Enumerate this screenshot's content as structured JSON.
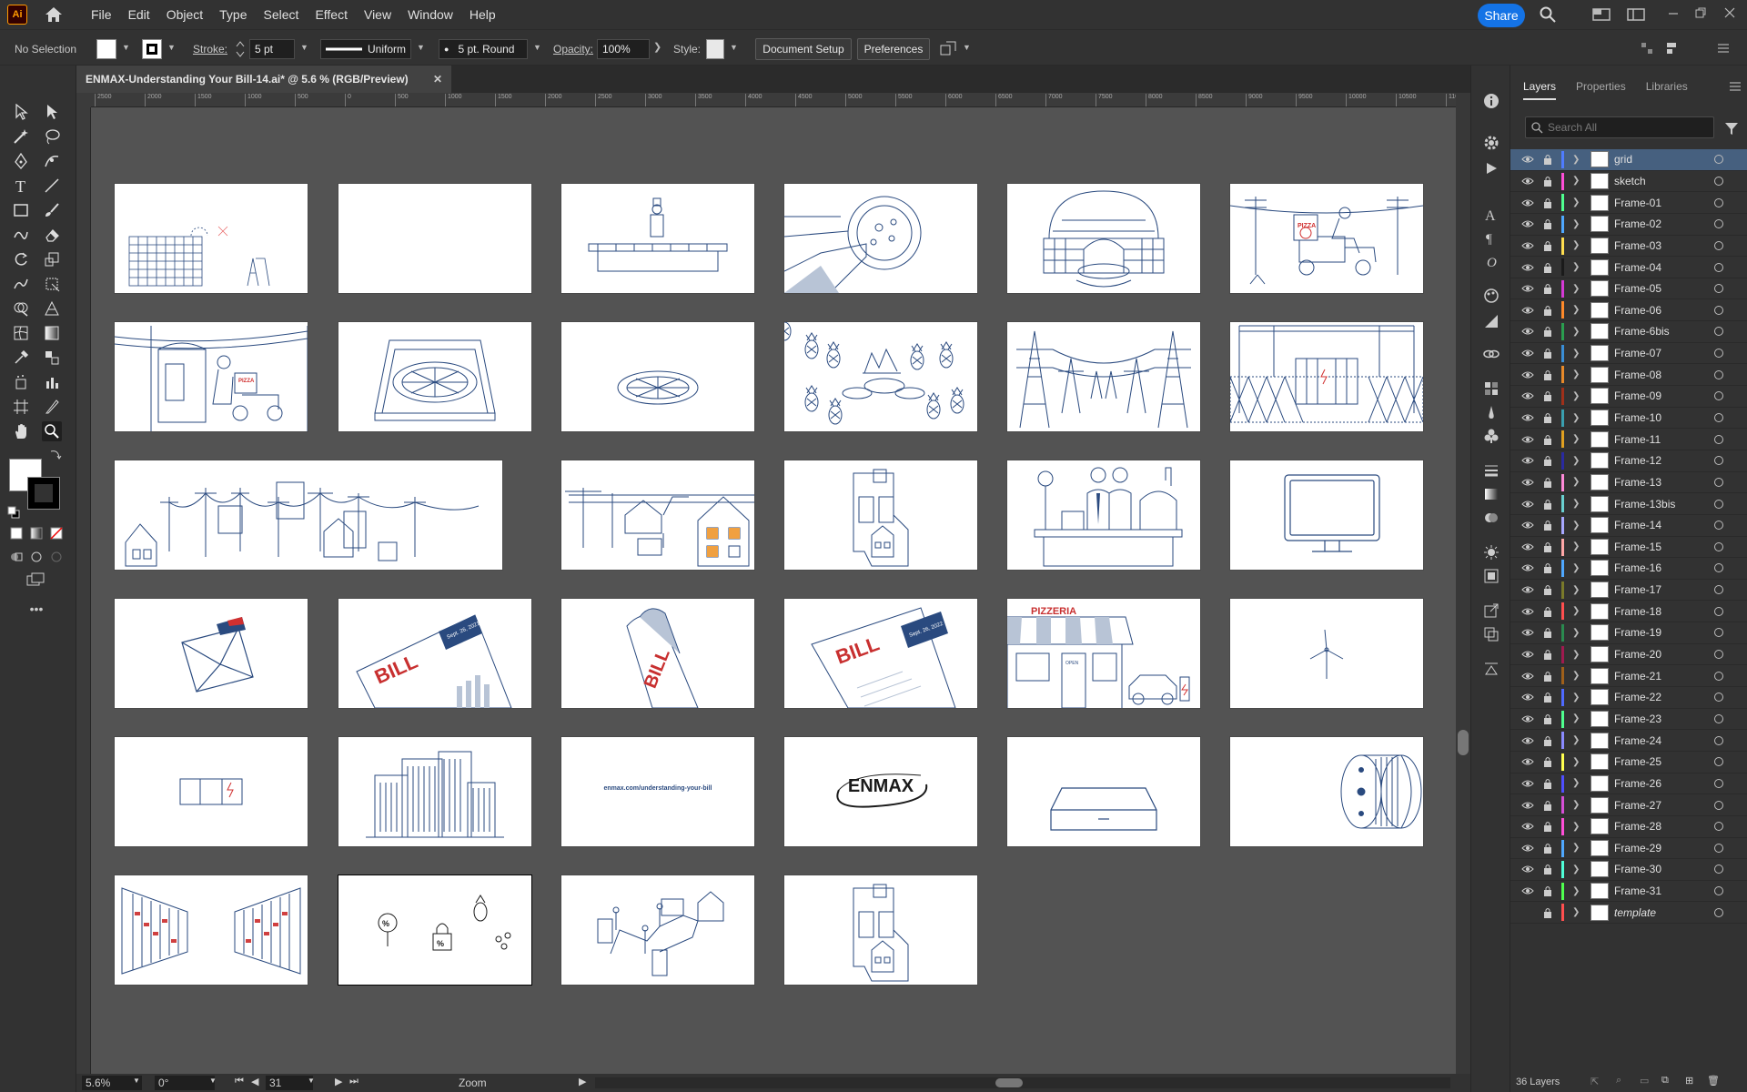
{
  "app": {
    "logo": "Ai"
  },
  "menu": [
    "File",
    "Edit",
    "Object",
    "Type",
    "Select",
    "Effect",
    "View",
    "Window",
    "Help"
  ],
  "share_label": "Share",
  "control_bar": {
    "selection": "No Selection",
    "stroke_label": "Stroke:",
    "stroke_value": "5 pt",
    "profile": "Uniform",
    "brush": "5 pt. Round",
    "opacity_label": "Opacity:",
    "opacity_value": "100%",
    "style_label": "Style:",
    "doc_setup": "Document Setup",
    "preferences": "Preferences"
  },
  "document": {
    "tab_title": "ENMAX-Understanding Your Bill-14.ai* @ 5.6 % (RGB/Preview)"
  },
  "ruler_ticks": [
    "2500",
    "2000",
    "1500",
    "1000",
    "500",
    "0",
    "500",
    "1000",
    "1500",
    "2000",
    "2500",
    "3000",
    "3500",
    "4000",
    "4500",
    "5000",
    "5500",
    "6000",
    "6500",
    "7000",
    "7500",
    "8000",
    "8500",
    "9000",
    "9500",
    "10000",
    "10500",
    "11000"
  ],
  "artboard_texts": {
    "bill": "BILL",
    "bill_date1": "Sept. 26, 2021",
    "bill_date2": "Sept. 26, 2022",
    "pizzeria": "PIZZERIA",
    "pizza": "PIZZA",
    "open": "OPEN",
    "url": "enmax.com/understanding-your-bill",
    "enmax": "ENMAX",
    "percent": "%"
  },
  "status": {
    "zoom": "5.6%",
    "rotation": "0°",
    "artboard_num": "31",
    "tool": "Zoom"
  },
  "layers_panel": {
    "tabs": [
      "Layers",
      "Properties",
      "Libraries"
    ],
    "search_placeholder": "Search All",
    "count": "36 Layers",
    "layers": [
      {
        "name": "grid",
        "color": "#4f7cff"
      },
      {
        "name": "sketch",
        "color": "#ff4fd8"
      },
      {
        "name": "Frame-01",
        "color": "#4fff8f"
      },
      {
        "name": "Frame-02",
        "color": "#4fa8ff"
      },
      {
        "name": "Frame-03",
        "color": "#ffde4f"
      },
      {
        "name": "Frame-04",
        "color": "#1a1a1a"
      },
      {
        "name": "Frame-05",
        "color": "#d63ad6"
      },
      {
        "name": "Frame-06",
        "color": "#ff8a2a"
      },
      {
        "name": "Frame-6bis",
        "color": "#2a9e4f"
      },
      {
        "name": "Frame-07",
        "color": "#3a8ed6"
      },
      {
        "name": "Frame-08",
        "color": "#e88a2a"
      },
      {
        "name": "Frame-09",
        "color": "#a0301a"
      },
      {
        "name": "Frame-10",
        "color": "#3aa0b0"
      },
      {
        "name": "Frame-11",
        "color": "#e0a020"
      },
      {
        "name": "Frame-12",
        "color": "#2a2aa0"
      },
      {
        "name": "Frame-13",
        "color": "#ff8ad8"
      },
      {
        "name": "Frame-13bis",
        "color": "#6ad0d0"
      },
      {
        "name": "Frame-14",
        "color": "#a8a8ff"
      },
      {
        "name": "Frame-15",
        "color": "#ffa8a8"
      },
      {
        "name": "Frame-16",
        "color": "#4fa8ff"
      },
      {
        "name": "Frame-17",
        "color": "#7a7a2a"
      },
      {
        "name": "Frame-18",
        "color": "#ff4f4f"
      },
      {
        "name": "Frame-19",
        "color": "#2a8a4f"
      },
      {
        "name": "Frame-20",
        "color": "#a01a4f"
      },
      {
        "name": "Frame-21",
        "color": "#a0601a"
      },
      {
        "name": "Frame-22",
        "color": "#4f6aff"
      },
      {
        "name": "Frame-23",
        "color": "#4fff8f"
      },
      {
        "name": "Frame-24",
        "color": "#8a8aff"
      },
      {
        "name": "Frame-25",
        "color": "#ffff4f"
      },
      {
        "name": "Frame-26",
        "color": "#4f4fff"
      },
      {
        "name": "Frame-27",
        "color": "#d64fd6"
      },
      {
        "name": "Frame-28",
        "color": "#ff4fd8"
      },
      {
        "name": "Frame-29",
        "color": "#4fa8ff"
      },
      {
        "name": "Frame-30",
        "color": "#4fffd8"
      },
      {
        "name": "Frame-31",
        "color": "#4fff4f"
      },
      {
        "name": "template",
        "color": "#ff4f4f",
        "template": true
      }
    ]
  }
}
